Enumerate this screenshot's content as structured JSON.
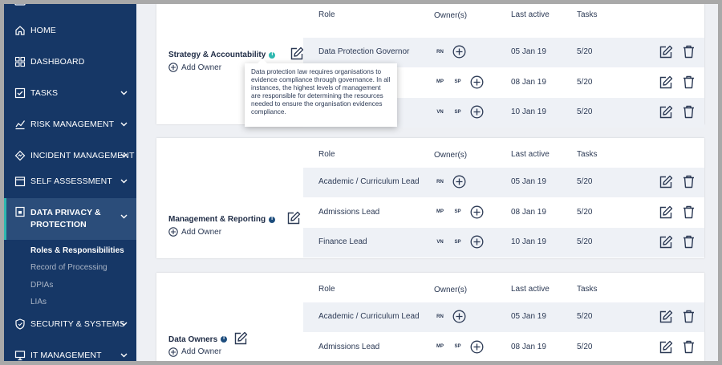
{
  "sidebar": {
    "items": [
      {
        "label": "HOME",
        "icon": "home-icon"
      },
      {
        "label": "DASHBOARD",
        "icon": "dashboard-icon"
      },
      {
        "label": "TASKS",
        "icon": "tasks-icon"
      },
      {
        "label": "RISK MANAGEMENT",
        "icon": "chart-icon"
      },
      {
        "label": "INCIDENT MANAGEMENT",
        "icon": "incident-icon"
      },
      {
        "label": "SELF ASSESSMENT",
        "icon": "assessment-icon"
      },
      {
        "label": "DATA PRIVACY &\nPROTECTION",
        "icon": "lock-icon"
      },
      {
        "label": "SECURITY & SYSTEMS",
        "icon": "shield-icon"
      },
      {
        "label": "IT MANAGEMENT",
        "icon": "monitor-icon"
      }
    ],
    "subitems": [
      "Roles & Responsibilities",
      "Record of Processing",
      "DPIAs",
      "LIAs"
    ]
  },
  "headers": {
    "role": "Role",
    "owners": "Owner(s)",
    "last_active": "Last active",
    "tasks": "Tasks"
  },
  "add_owner_label": "Add Owner",
  "tooltip_text": "Data protection law requires organisations to evidence compliance through governance. In all instances, the highest levels of management are responsible for determining the resources needed to ensure the organisation evidences compliance.",
  "colors": {
    "sidebar": "#163766",
    "accent": "#2fb8b0",
    "info": "#1d4d7d"
  },
  "groups": [
    {
      "title": "Strategy & Accountability",
      "rows": [
        {
          "role": "Data Protection Governor",
          "owners": [
            "RN"
          ],
          "date": "05 Jan 19",
          "tasks": "5/20"
        },
        {
          "role": "",
          "owners": [
            "MP",
            "SP"
          ],
          "date": "08 Jan 19",
          "tasks": "5/20"
        },
        {
          "role": "",
          "owners": [
            "VN",
            "SP"
          ],
          "date": "10 Jan 19",
          "tasks": "5/20"
        }
      ]
    },
    {
      "title": "Management & Reporting",
      "rows": [
        {
          "role": "Academic / Curriculum Lead",
          "owners": [
            "RN"
          ],
          "date": "05 Jan 19",
          "tasks": "5/20"
        },
        {
          "role": "Admissions Lead",
          "owners": [
            "MP",
            "SP"
          ],
          "date": "08 Jan 19",
          "tasks": "5/20"
        },
        {
          "role": "Finance Lead",
          "owners": [
            "VN",
            "SP"
          ],
          "date": "10 Jan 19",
          "tasks": "5/20"
        }
      ]
    },
    {
      "title": "Data Owners",
      "rows": [
        {
          "role": "Academic / Curriculum Lead",
          "owners": [
            "RN"
          ],
          "date": "05 Jan 19",
          "tasks": "5/20"
        },
        {
          "role": "Admissions Lead",
          "owners": [
            "MP",
            "SP"
          ],
          "date": "08 Jan 19",
          "tasks": "5/20"
        }
      ]
    }
  ]
}
